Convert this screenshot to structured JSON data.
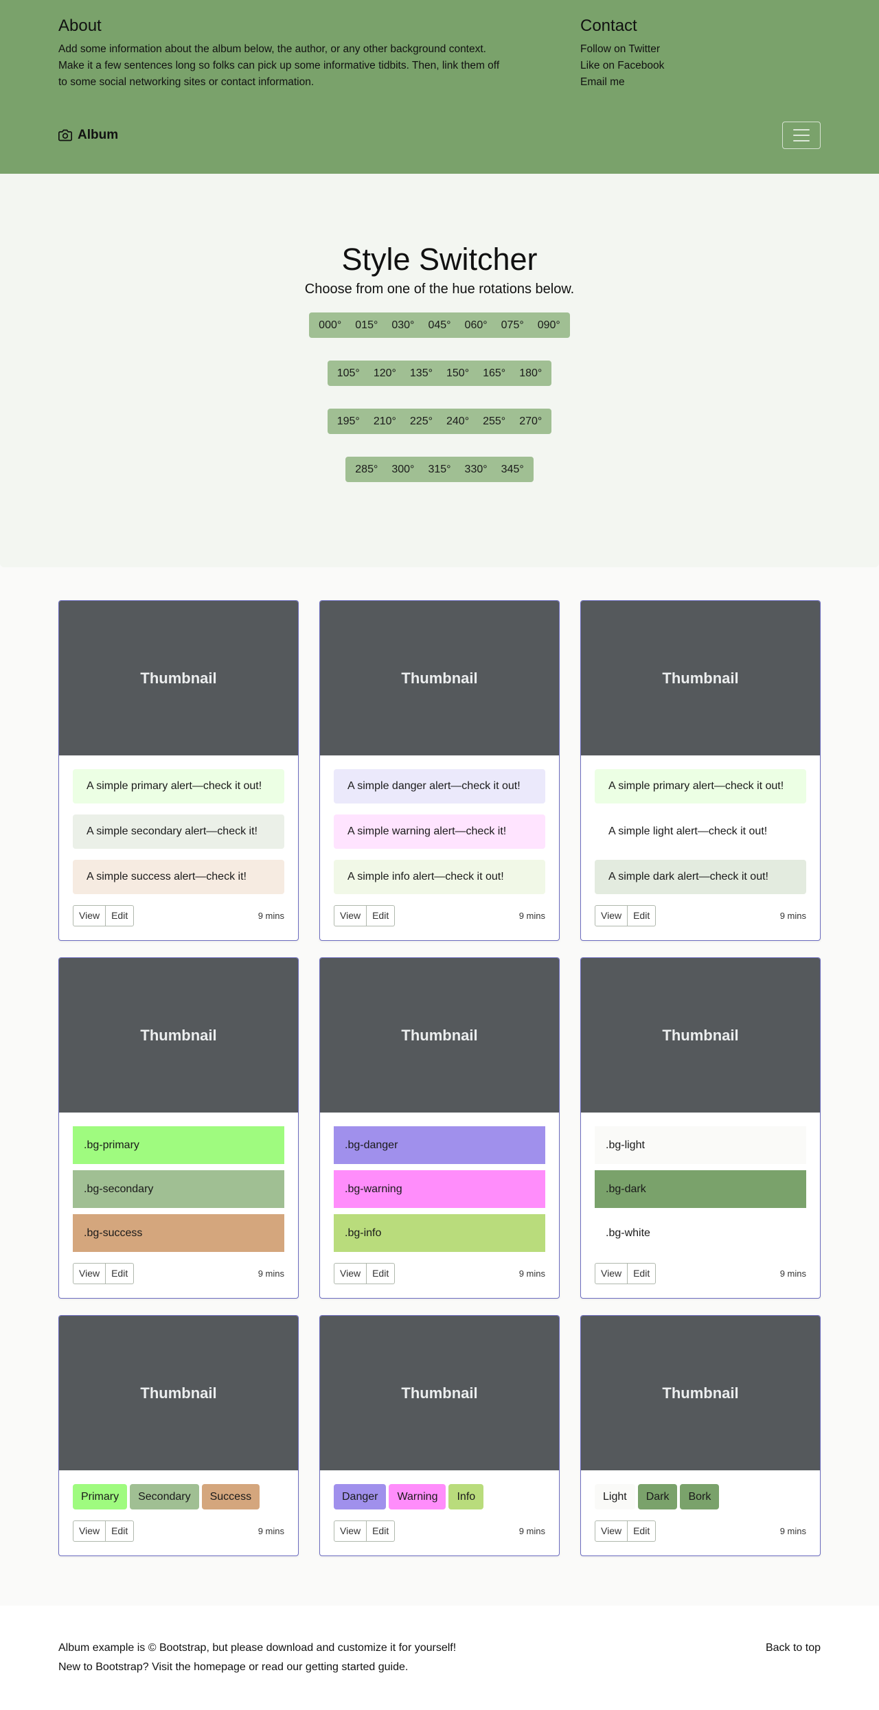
{
  "header": {
    "about_title": "About",
    "about_text": "Add some information about the album below, the author, or any other background context. Make it a few sentences long so folks can pick up some informative tidbits. Then, link them off to some social networking sites or contact information.",
    "contact_title": "Contact",
    "contact_links": [
      "Follow on Twitter",
      "Like on Facebook",
      "Email me"
    ]
  },
  "navbar": {
    "brand": "Album",
    "icons": {
      "brand": "camera-icon",
      "toggler": "hamburger-icon"
    }
  },
  "jumbotron": {
    "title": "Style Switcher",
    "lead": "Choose from one of the hue rotations below.",
    "hue_rows": [
      [
        "000°",
        "015°",
        "030°",
        "045°",
        "060°",
        "075°",
        "090°"
      ],
      [
        "105°",
        "120°",
        "135°",
        "150°",
        "165°",
        "180°"
      ],
      [
        "195°",
        "210°",
        "225°",
        "240°",
        "255°",
        "270°"
      ],
      [
        "285°",
        "300°",
        "315°",
        "330°",
        "345°"
      ]
    ]
  },
  "cards": {
    "thumbnail_label": "Thumbnail",
    "view_label": "View",
    "edit_label": "Edit",
    "time_label": "9 mins",
    "alert_cards": [
      [
        {
          "text": "A simple primary alert—check it out!",
          "color": "#ecffe4"
        },
        {
          "text": "A simple secondary alert—check it!",
          "color": "#ebf0e8"
        },
        {
          "text": "A simple success alert—check it!",
          "color": "#f6ebe1"
        }
      ],
      [
        {
          "text": "A simple danger alert—check it out!",
          "color": "#ebe9fb"
        },
        {
          "text": "A simple warning alert—check it!",
          "color": "#ffe4ff"
        },
        {
          "text": "A simple info alert—check it out!",
          "color": "#f1f8e7"
        }
      ],
      [
        {
          "text": "A simple primary alert—check it out!",
          "color": "#ecffe4"
        },
        {
          "text": "A simple light alert—check it out!",
          "color": "#ffffff"
        },
        {
          "text": "A simple dark alert—check it out!",
          "color": "#e3ebdf"
        }
      ]
    ],
    "bg_cards": [
      [
        {
          "text": ".bg-primary",
          "color": "#9ffb7f"
        },
        {
          "text": ".bg-secondary",
          "color": "#a0bf93"
        },
        {
          "text": ".bg-success",
          "color": "#d4a67d"
        }
      ],
      [
        {
          "text": ".bg-danger",
          "color": "#a090ec"
        },
        {
          "text": ".bg-warning",
          "color": "#ff8dfb"
        },
        {
          "text": ".bg-info",
          "color": "#b9dc7c"
        }
      ],
      [
        {
          "text": ".bg-light",
          "color": "#fafaf8"
        },
        {
          "text": ".bg-dark",
          "color": "#7aa26b"
        },
        {
          "text": ".bg-white",
          "color": "#ffffff"
        }
      ]
    ],
    "button_cards": [
      [
        {
          "text": "Primary",
          "color": "#9ffb7f"
        },
        {
          "text": "Secondary",
          "color": "#a0bf93"
        },
        {
          "text": "Success",
          "color": "#d4a67d"
        }
      ],
      [
        {
          "text": "Danger",
          "color": "#a090ec"
        },
        {
          "text": "Warning",
          "color": "#ff8dfb"
        },
        {
          "text": "Info",
          "color": "#b9dc7c"
        }
      ],
      [
        {
          "text": "Light",
          "color": "#fafaf8"
        },
        {
          "text": "Dark",
          "color": "#7aa26b"
        },
        {
          "text": "Bork",
          "color": "#7aa26b"
        }
      ]
    ]
  },
  "footer": {
    "line1": "Album example is © Bootstrap, but please download and customize it for yourself!",
    "line2": "New to Bootstrap? Visit the homepage or read our getting started guide.",
    "back_to_top": "Back to top"
  }
}
